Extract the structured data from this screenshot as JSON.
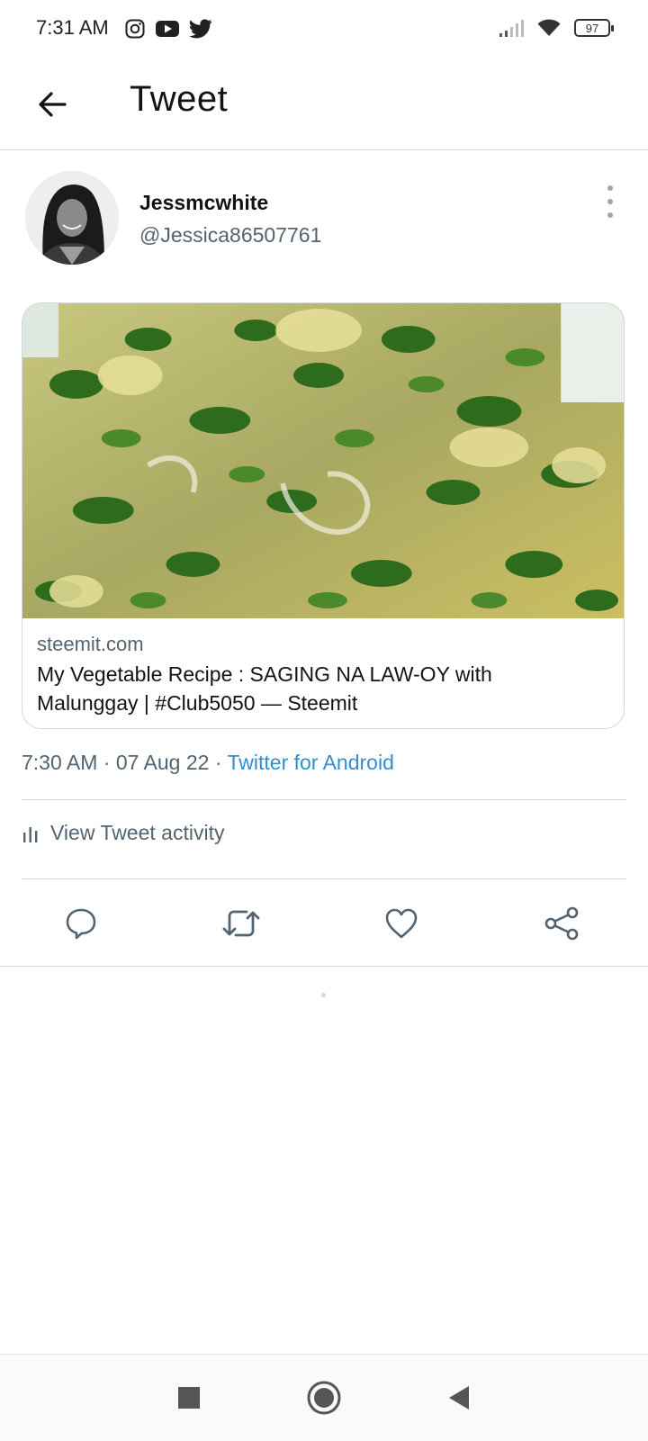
{
  "status_bar": {
    "time": "7:31 AM",
    "app_icons": [
      "instagram-icon",
      "youtube-icon",
      "twitter-icon"
    ],
    "battery": "97"
  },
  "header": {
    "title": "Tweet"
  },
  "author": {
    "name": "Jessmcwhite",
    "handle": "@Jessica86507761"
  },
  "card": {
    "domain": "steemit.com",
    "title": "My Vegetable Recipe : SAGING NA LAW-OY with Malunggay | #Club5050 — Steemit"
  },
  "meta": {
    "time": "7:30 AM",
    "separator": "·",
    "date": "07 Aug 22",
    "source": "Twitter for Android"
  },
  "activity": {
    "label": "View Tweet activity"
  },
  "colors": {
    "link_blue": "#2f8fd0",
    "secondary_text": "#536471",
    "divider": "#cfd9de"
  }
}
